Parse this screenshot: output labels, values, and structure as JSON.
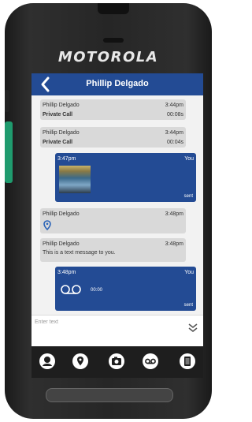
{
  "device": {
    "brand": "MOTOROLA"
  },
  "header": {
    "title": "Phillip Delgado"
  },
  "messages": [
    {
      "type": "call",
      "name": "Phillip Delgado",
      "time": "3:44pm",
      "label": "Private Call",
      "duration": "00:08s"
    },
    {
      "type": "call",
      "name": "Phillip Delgado",
      "time": "3:44pm",
      "label": "Private Call",
      "duration": "00:04s"
    },
    {
      "type": "image",
      "time": "3:47pm",
      "sender": "You",
      "status": "sent"
    },
    {
      "type": "location",
      "name": "Phillip Delgado",
      "time": "3:48pm"
    },
    {
      "type": "text",
      "name": "Phillip Delgado",
      "time": "3:48pm",
      "text": "This is a text message to you."
    },
    {
      "type": "voice",
      "time": "3:48pm",
      "sender": "You",
      "duration": "00:00",
      "status": "sent"
    }
  ],
  "composer": {
    "placeholder": "Enter text"
  },
  "toolbar": {
    "icons": [
      "contact-icon",
      "location-icon",
      "camera-icon",
      "voicemail-icon",
      "note-icon"
    ]
  },
  "colors": {
    "accent": "#234b94",
    "incoming": "#d9d9d9",
    "side_button": "#1f9b6e"
  }
}
